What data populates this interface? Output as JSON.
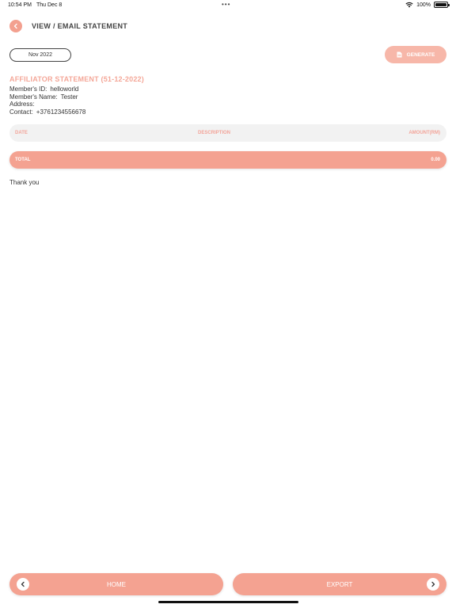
{
  "status_bar": {
    "time": "10:54 PM",
    "date": "Thu Dec 8",
    "dots": "•••",
    "battery": "100%"
  },
  "header": {
    "title": "VIEW / EMAIL STATEMENT"
  },
  "controls": {
    "month": "Nov 2022",
    "generate_label": "GENERATE"
  },
  "statement": {
    "title": "AFFILIATOR STATEMENT (51-12-2022)",
    "member_id_label": "Member's ID:",
    "member_id": "helloworld",
    "member_name_label": "Member's Name:",
    "member_name": "Tester",
    "address_label": "Address:",
    "address": "",
    "contact_label": "Contact:",
    "contact": "+3761234556678"
  },
  "table": {
    "columns": [
      "DATE",
      "DESCRIPTION",
      "AMOUNT(RM)"
    ],
    "rows": []
  },
  "total": {
    "label": "TOTAL",
    "value": "0.00"
  },
  "footer_text": "Thank you",
  "bottom": {
    "home_label": "HOME",
    "export_label": "EXPORT"
  },
  "colors": {
    "accent": "#f4a291",
    "accent_light": "#f7b7a9",
    "header_text": "#f3a59a",
    "row_bg": "#f2f2f2"
  },
  "icons": {
    "back": "chevron-left-icon",
    "generate": "document-icon",
    "home": "chevron-left-icon",
    "export": "chevron-right-icon"
  }
}
